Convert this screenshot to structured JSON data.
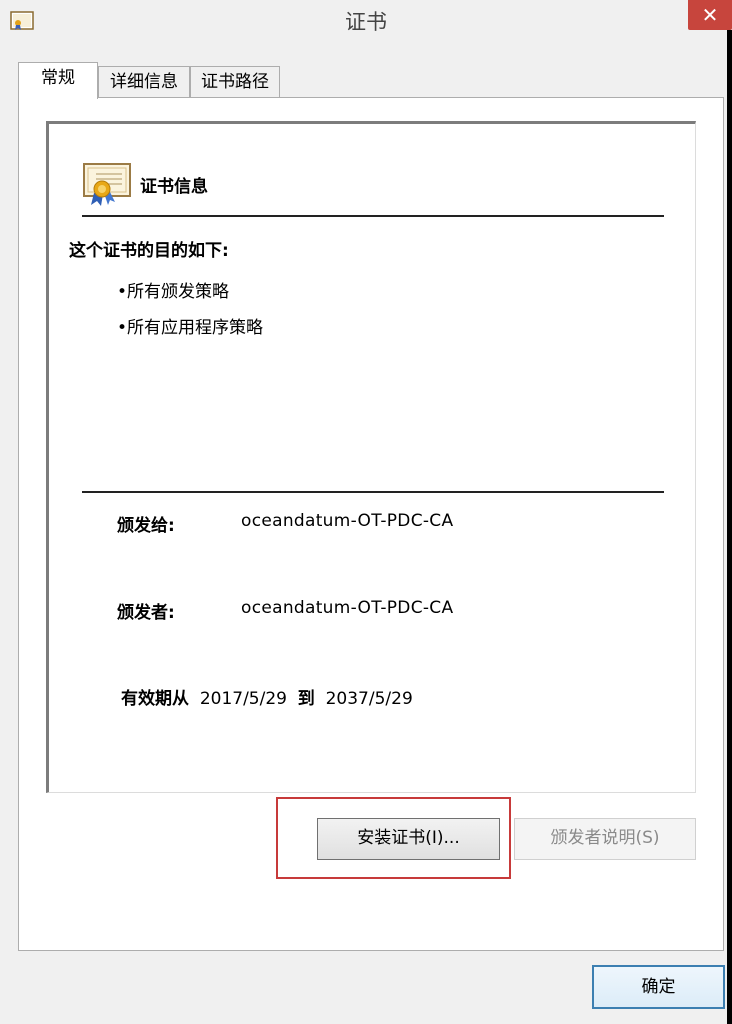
{
  "window": {
    "title": "证书",
    "close_symbol": "✕"
  },
  "tabs": [
    {
      "label": "常规",
      "active": true
    },
    {
      "label": "详细信息",
      "active": false
    },
    {
      "label": "证书路径",
      "active": false
    }
  ],
  "cert": {
    "info_title": "证书信息",
    "purpose_heading": "这个证书的目的如下:",
    "purposes": [
      "•所有颁发策略",
      "•所有应用程序策略"
    ],
    "issued_to_label": "颁发给:",
    "issued_to_value": "oceandatum-OT-PDC-CA",
    "issued_by_label": "颁发者:",
    "issued_by_value": "oceandatum-OT-PDC-CA",
    "valid_from_label": "有效期从",
    "valid_from": "2017/5/29",
    "valid_to_label": "到",
    "valid_to": "2037/5/29"
  },
  "buttons": {
    "install": "安装证书(I)...",
    "issuer_statement": "颁发者说明(S)",
    "ok": "确定"
  },
  "icons": {
    "titlebar": "certificate-icon",
    "info": "certificate-ribbon-icon"
  },
  "colors": {
    "close_button": "#c7453d",
    "highlight": "#c73a3a",
    "ok_border": "#3c7fb1"
  }
}
